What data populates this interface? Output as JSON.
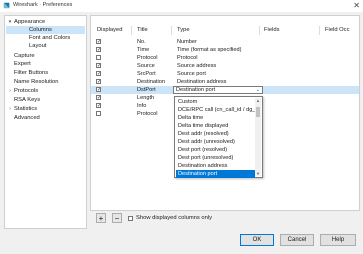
{
  "window": {
    "title": "Wireshark · Preferences",
    "close_glyph": "✕"
  },
  "tree": {
    "items": [
      {
        "label": "Appearance",
        "arrow": "▾",
        "level": 0
      },
      {
        "label": "Columns",
        "arrow": "",
        "level": 1,
        "selected": true
      },
      {
        "label": "Font and Colors",
        "arrow": "",
        "level": 1
      },
      {
        "label": "Layout",
        "arrow": "",
        "level": 1
      },
      {
        "label": "Capture",
        "arrow": "",
        "level": 0
      },
      {
        "label": "Expert",
        "arrow": "",
        "level": 0
      },
      {
        "label": "Filter Buttons",
        "arrow": "",
        "level": 0
      },
      {
        "label": "Name Resolution",
        "arrow": "",
        "level": 0
      },
      {
        "label": "Protocols",
        "arrow": "›",
        "level": 0
      },
      {
        "label": "RSA Keys",
        "arrow": "",
        "level": 0
      },
      {
        "label": "Statistics",
        "arrow": "›",
        "level": 0
      },
      {
        "label": "Advanced",
        "arrow": "",
        "level": 0
      }
    ]
  },
  "columns_table": {
    "headers": [
      "Displayed",
      "Title",
      "Type",
      "Fields",
      "Field Occ"
    ],
    "rows": [
      {
        "checked": true,
        "check_glyph": "✓",
        "title": "No.",
        "type": "Number"
      },
      {
        "checked": true,
        "check_glyph": "✓",
        "title": "Time",
        "type": "Time (format as specified)"
      },
      {
        "checked": false,
        "check_glyph": "",
        "title": "Protocol",
        "type": "Protocol"
      },
      {
        "checked": true,
        "check_glyph": "✓",
        "title": "Source",
        "type": "Source address"
      },
      {
        "checked": true,
        "check_glyph": "✓",
        "title": "SrcPort",
        "type": "Source port"
      },
      {
        "checked": true,
        "check_glyph": "✓",
        "title": "Destination",
        "type": "Destination address"
      },
      {
        "checked": true,
        "check_glyph": "✓",
        "title": "DstPort",
        "type": "Destination port",
        "selected": true
      },
      {
        "checked": true,
        "check_glyph": "✓",
        "title": "Length",
        "type": ""
      },
      {
        "checked": true,
        "check_glyph": "✓",
        "title": "Info",
        "type": ""
      },
      {
        "checked": false,
        "check_glyph": "",
        "title": "Protocol",
        "type": ""
      }
    ],
    "type_dropdown": {
      "value": "Destination port",
      "chevron": "⌄",
      "options": [
        "Custom",
        "DCE/RPC call (cn_call_id / dg_seqnum)",
        "Delta time",
        "Delta time displayed",
        "Dest addr (resolved)",
        "Dest addr (unresolved)",
        "Dest port (resolved)",
        "Dest port (unresolved)",
        "Destination address",
        "Destination port"
      ],
      "selected_option": "Destination port"
    }
  },
  "bottom": {
    "add_glyph": "+",
    "remove_glyph": "−",
    "show_displayed_label": "Show displayed columns only",
    "show_displayed_checked": false
  },
  "buttons": {
    "ok": "OK",
    "cancel": "Cancel",
    "help": "Help"
  },
  "colors": {
    "selection": "#cce4f7",
    "accent": "#0078d7"
  }
}
